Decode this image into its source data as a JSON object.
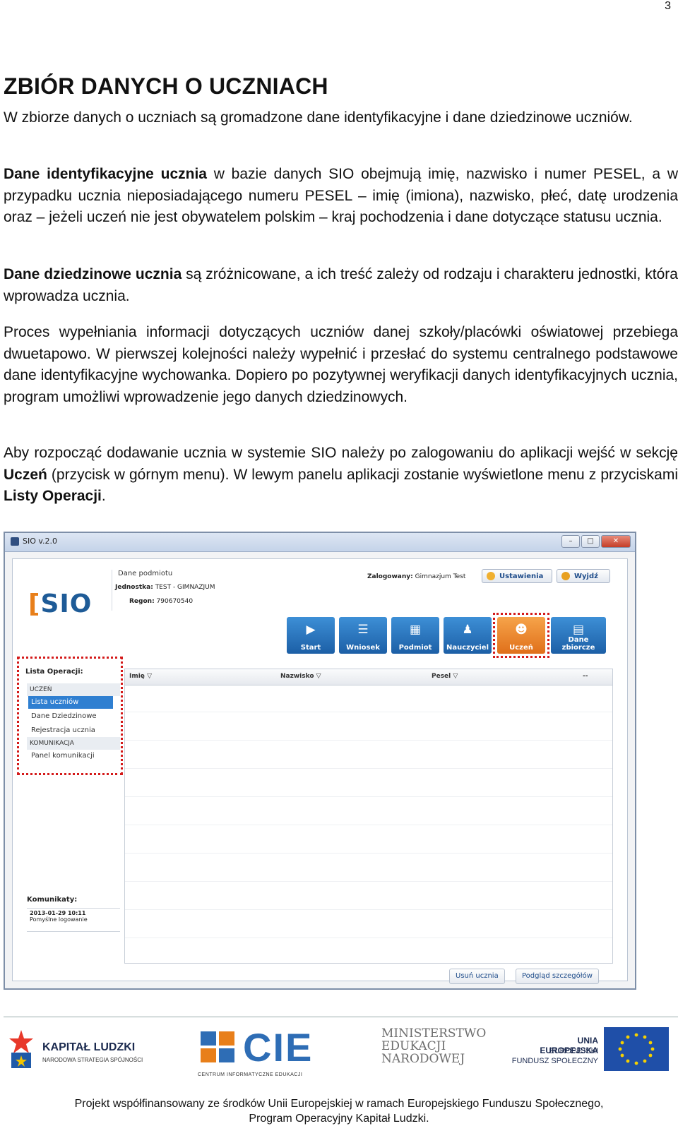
{
  "page_number": "3",
  "heading": "ZBIÓR DANYCH O UCZNIACH",
  "p1": "W zbiorze danych o uczniach są gromadzone dane identyfikacyjne i dane dziedzinowe uczniów.",
  "p2_bold": "Dane identyfikacyjne ucznia",
  "p2_rest": " w bazie danych SIO obejmują imię, nazwisko i numer PESEL, a w przypadku ucznia nieposiadającego numeru PESEL – imię (imiona), nazwisko, płeć, datę urodzenia oraz – jeżeli uczeń nie jest obywatelem polskim – kraj pochodzenia i dane dotyczące statusu ucznia.",
  "p3_bold": "Dane dziedzinowe ucznia",
  "p3_rest": " są zróżnicowane, a ich treść zależy od rodzaju i charakteru jednostki, która wprowadza ucznia.",
  "p4": "Proces wypełniania informacji dotyczących uczniów danej szkoły/placówki oświatowej przebiega dwuetapowo. W pierwszej kolejności należy wypełnić i przesłać do systemu centralnego podstawowe dane identyfikacyjne wychowanka. Dopiero po pozytywnej weryfikacji danych identyfikacyjnych ucznia, program umożliwi wprowadzenie jego danych dziedzinowych.",
  "p5_a": "Aby rozpocząć dodawanie ucznia w systemie SIO należy po zalogowaniu do aplikacji wejść w sekcję ",
  "p5_b": "Uczeń",
  "p5_c": " (przycisk w górnym menu). W lewym panelu aplikacji zostanie wyświetlone menu z przyciskami ",
  "p5_d": "Listy Operacji",
  "p5_e": ".",
  "app": {
    "window_title": "SIO v.2.0",
    "logo": "SIO",
    "entity_title": "Dane podmiotu",
    "unit_label": "Jednostka:",
    "unit_value": "TEST - GIMNAZJUM",
    "regon_label": "Regon:",
    "regon_value": "790670540",
    "logged_label": "Zalogowany:",
    "logged_value": "Gimnazjum Test",
    "settings": "Ustawienia",
    "logout": "Wyjdź",
    "nav": [
      "Start",
      "Wniosek",
      "Podmiot",
      "Nauczyciel",
      "Uczeń",
      "Dane zbiorcze"
    ],
    "ops_title": "Lista Operacji:",
    "ops_section1": "UCZEŃ",
    "ops_items": [
      "Lista uczniów",
      "Dane Dziedzinowe",
      "Rejestracja ucznia"
    ],
    "ops_section2": "KOMUNIKACJA",
    "ops_item4": "Panel komunikacji",
    "columns": [
      "Imię",
      "Nazwisko",
      "Pesel",
      "--"
    ],
    "messages_title": "Komunikaty:",
    "message_date": "2013-01-29 10:11",
    "message_text": "Pomyślne logowanie",
    "btn_delete": "Usuń ucznia",
    "btn_preview": "Podgląd szczegółów"
  },
  "footer": {
    "logo1": "KAPITAŁ LUDZKI",
    "logo1_sub": "NARODOWA STRATEGIA SPÓJNOŚCI",
    "logo2": "CIE",
    "logo2_sub": "CENTRUM INFORMATYCZNE EDUKACJI",
    "logo3_l1": "MINISTERSTWO",
    "logo3_l2": "EDUKACJI",
    "logo3_l3": "NARODOWEJ",
    "logo4_l1": "UNIA EUROPEJSKA",
    "logo4_l2": "EUROPEJSKI",
    "logo4_l3": "FUNDUSZ SPOŁECZNY",
    "line1": "Projekt współfinansowany ze środków Unii Europejskiej w ramach Europejskiego Funduszu Społecznego,",
    "line2": "Program Operacyjny Kapitał Ludzki."
  }
}
